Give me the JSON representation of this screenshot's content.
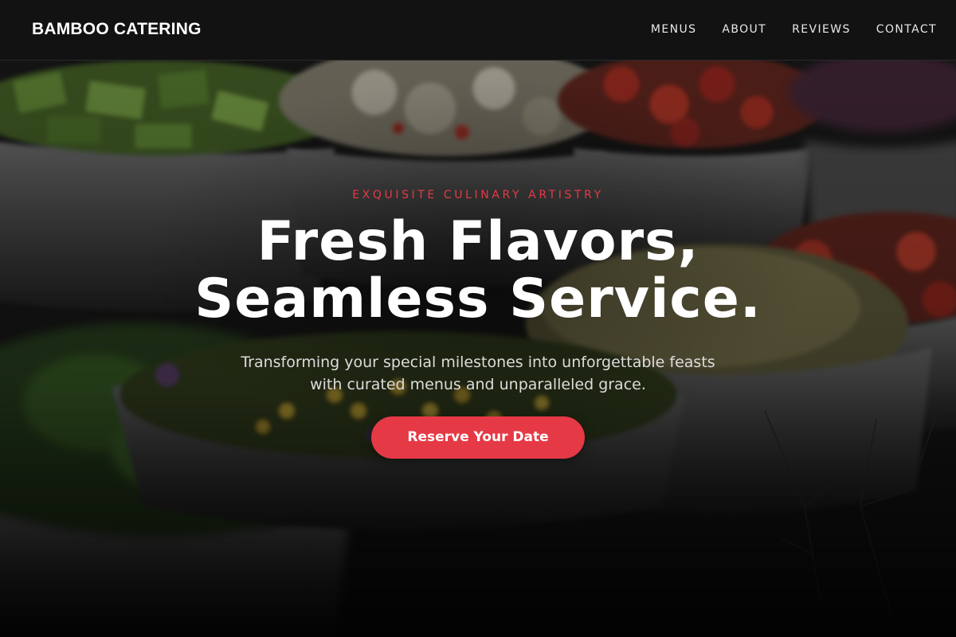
{
  "header": {
    "brand": "BAMBOO CATERING",
    "nav": [
      "MENUS",
      "ABOUT",
      "REVIEWS",
      "CONTACT"
    ]
  },
  "hero": {
    "eyebrow": "EXQUISITE CULINARY ARTISTRY",
    "headline_line1": "Fresh Flavors,",
    "headline_line2": "Seamless Service.",
    "subtitle_line1": "Transforming your special milestones into unforgettable feasts",
    "subtitle_line2": "with curated menus and unparalleled grace.",
    "cta_label": "Reserve Your Date"
  },
  "colors": {
    "accent": "#e63946",
    "nav_bg": "#121212",
    "text": "#ffffff"
  }
}
